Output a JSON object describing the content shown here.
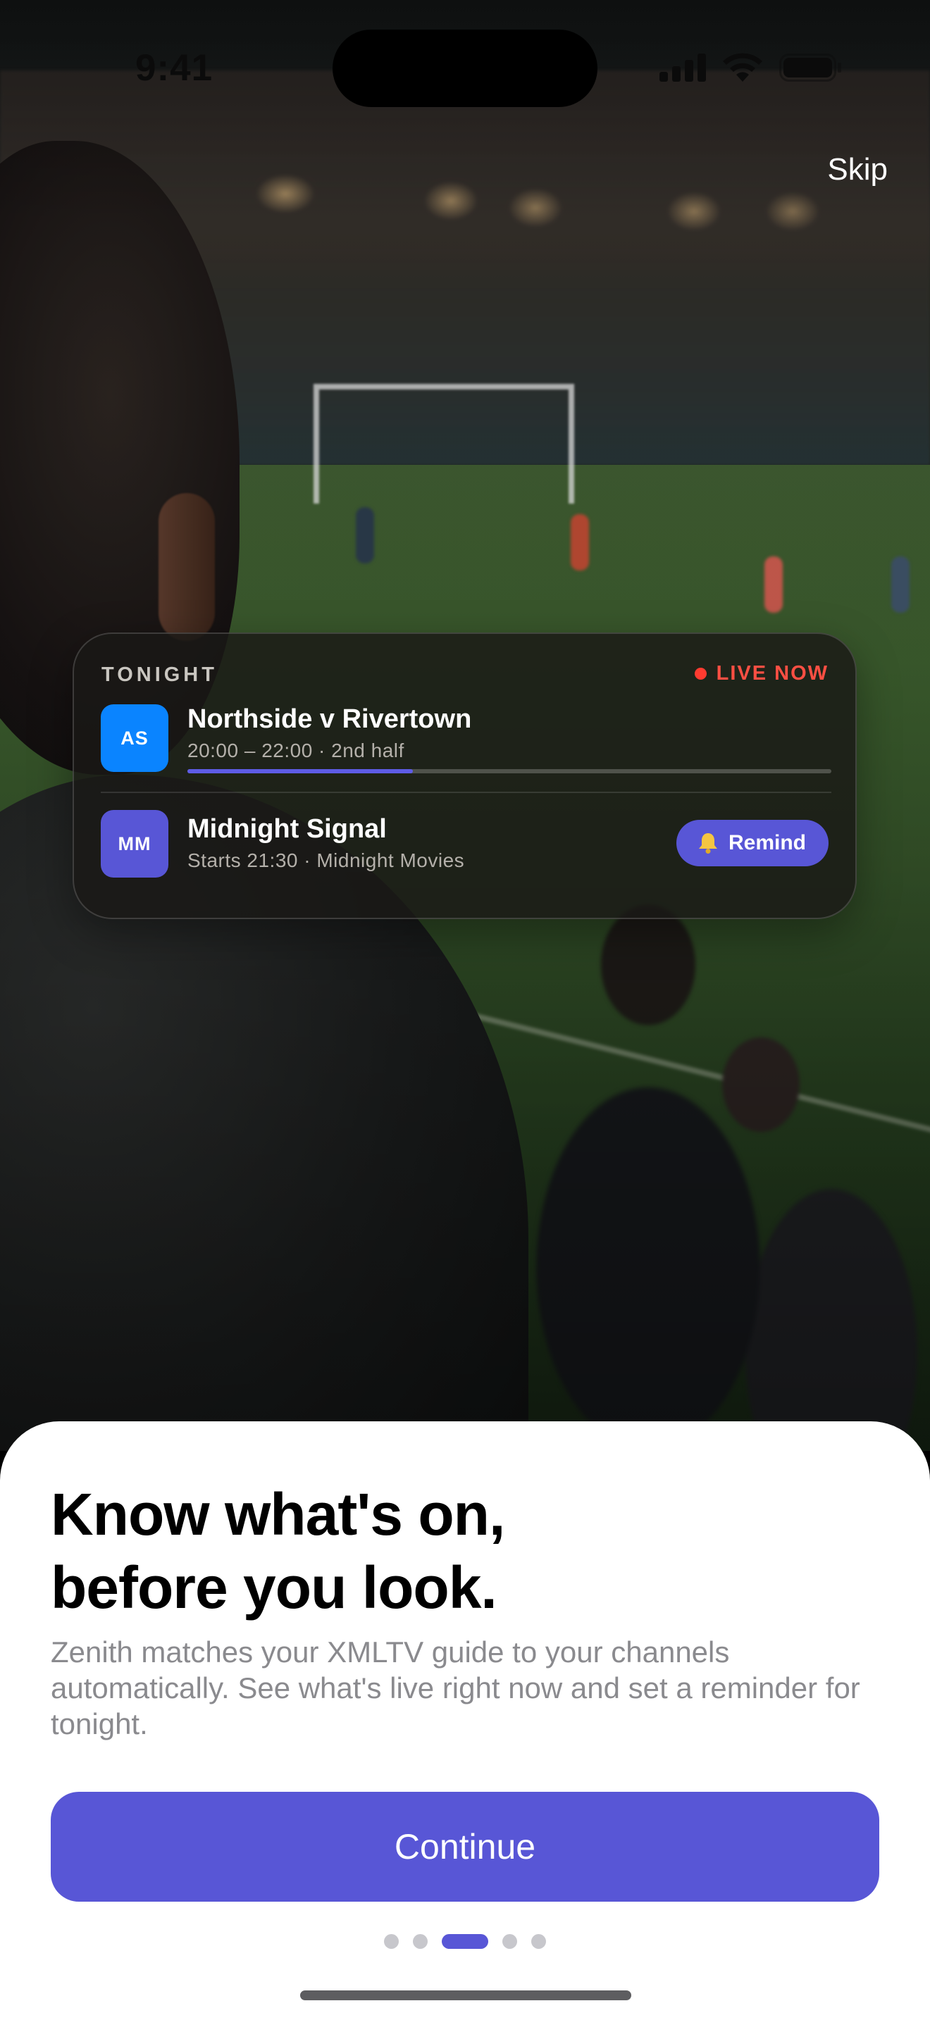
{
  "status_bar": {
    "time": "9:41"
  },
  "header": {
    "skip_label": "Skip"
  },
  "card": {
    "section_label": "TONIGHT",
    "live_label": "LIVE NOW",
    "programs": [
      {
        "badge": "AS",
        "title": "Northside v Rivertown",
        "subtitle": "20:00 – 22:00 · 2nd half",
        "progress": 0.35,
        "badge_color": "#0a84ff"
      },
      {
        "badge": "MM",
        "title": "Midnight Signal",
        "subtitle": "Starts 21:30 · Midnight Movies",
        "action_label": "Remind",
        "action_icon": "bell-icon",
        "badge_color": "#5856d6"
      }
    ]
  },
  "sheet": {
    "headline_line1": "Know what's on,",
    "headline_line2": "before you look.",
    "body": "Zenith matches your XMLTV guide to your channels automatically. See what's live right now and set a reminder for tonight.",
    "continue_label": "Continue"
  },
  "pagination": {
    "count": 5,
    "active_index": 2
  },
  "colors": {
    "accent": "#5856d6",
    "live": "#ff3b30",
    "blue_badge": "#0a84ff"
  }
}
